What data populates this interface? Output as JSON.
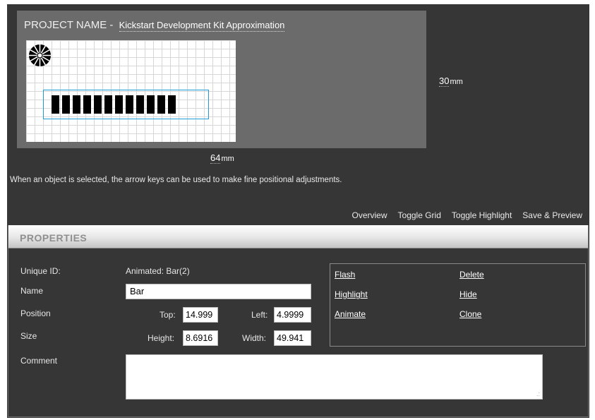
{
  "project": {
    "label": "PROJECT NAME - ",
    "name": "Kickstart Development Kit Approximation"
  },
  "dimensions": {
    "height_value": "30",
    "width_value": "64",
    "unit": "mm"
  },
  "hint": "When an object is selected, the arrow keys can be used to make fine positional adjustments.",
  "toolbar": {
    "overview": "Overview",
    "toggle_grid": "Toggle Grid",
    "toggle_highlight": "Toggle Highlight",
    "save_preview": "Save & Preview"
  },
  "properties": {
    "header": "PROPERTIES",
    "unique_id_label": "Unique ID:",
    "unique_id_value": "Animated: Bar(2)",
    "name_label": "Name",
    "name_value": "Bar",
    "position_label": "Position",
    "top_label": "Top:",
    "top_value": "14.999",
    "left_label": "Left:",
    "left_value": "4.9999",
    "size_label": "Size",
    "height_label": "Height:",
    "height_value": "8.6916",
    "width_label": "Width:",
    "width_value": "49.941",
    "comment_label": "Comment",
    "comment_value": ""
  },
  "actions": {
    "flash": "Flash",
    "highlight": "Highlight",
    "animate": "Animate",
    "delete": "Delete",
    "hide": "Hide",
    "clone": "Clone"
  },
  "colors": {
    "background": "#363636",
    "panel": "#6b6b6b",
    "selection": "#1e9bd7"
  }
}
